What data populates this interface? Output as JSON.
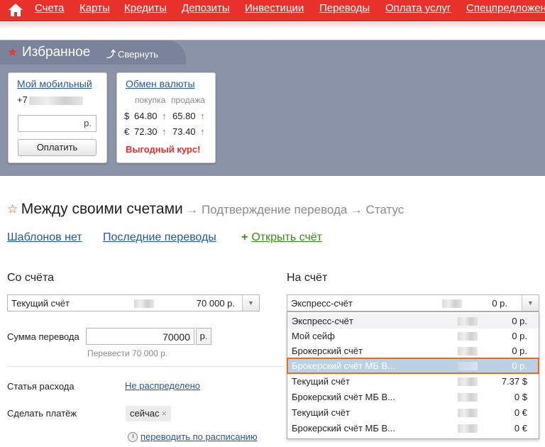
{
  "nav": {
    "items": [
      "Счета",
      "Карты",
      "Кредиты",
      "Депозиты",
      "Инвестиции",
      "Переводы",
      "Оплата услуг",
      "Спецпредложения"
    ]
  },
  "favorites": {
    "title": "Избранное",
    "collapse_label": "Свернуть",
    "mobile": {
      "title": "Мой мобильный",
      "phone_prefix": "+7",
      "currency": "р.",
      "pay_label": "Оплатить"
    },
    "fx": {
      "title": "Обмен валюты",
      "buy_label": "покупка",
      "sell_label": "продажа",
      "rates": [
        {
          "symbol": "$",
          "buy": "64.80",
          "sell": "65.80"
        },
        {
          "symbol": "€",
          "buy": "72.30",
          "sell": "73.40"
        }
      ],
      "arrow": "↑",
      "best_rate": "Выгодный курс!"
    }
  },
  "page": {
    "title": "Между своими счетами",
    "step2": "→ Подтверждение перевода",
    "step3": "→ Статус",
    "templates_link": "Шаблонов нет",
    "recent_link": "Последние переводы",
    "open_account": "Открыть счёт",
    "plus": "+"
  },
  "from": {
    "heading": "Со счёта",
    "account": "Текущий счёт",
    "amount": "70 000 р."
  },
  "to": {
    "heading": "На счёт",
    "account": "Экспресс-счёт",
    "amount": "0 р."
  },
  "transfer": {
    "label": "Сумма перевода",
    "value": "70000",
    "currency": "р.",
    "hint": "Перевести 70 000 р."
  },
  "expense": {
    "label": "Статья расхода",
    "value": "Не распределено"
  },
  "payment": {
    "label": "Сделать платёж",
    "now": "сейчас",
    "remove": "×",
    "schedule": "переводить по расписанию"
  },
  "dropdown": [
    {
      "name": "Экспресс-счёт",
      "value": "0 р."
    },
    {
      "name": "Мой сейф",
      "value": "0 р."
    },
    {
      "name": "Брокерский счёт",
      "value": "0 р."
    },
    {
      "name": "Брокерский счёт МБ В...",
      "value": "0 р."
    },
    {
      "name": "Текущий счёт",
      "value": "7.37 $"
    },
    {
      "name": "Брокерский счёт МБ В...",
      "value": "0 $"
    },
    {
      "name": "Текущий счёт",
      "value": "0 €"
    },
    {
      "name": "Брокерский счёт МБ В...",
      "value": "0 €"
    }
  ],
  "select_arrow": "▼",
  "colors": {
    "nav_red": "#e8312b",
    "panel": "#8a93a8",
    "link": "#24579a",
    "green": "#3a8a1a",
    "highlight_border": "#ee6a1c"
  }
}
